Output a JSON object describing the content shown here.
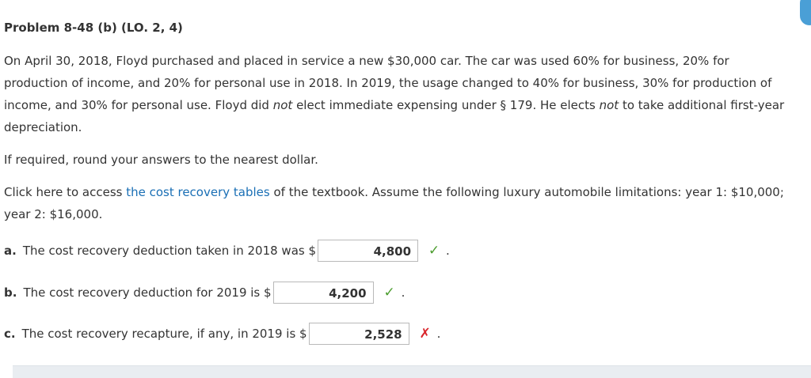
{
  "problem": {
    "title": "Problem 8-48 (b) (LO. 2, 4)",
    "para1_pre_not1": "On April 30, 2018, Floyd purchased and placed in service a new $30,000 car. The car was used 60% for business, 20% for production of income, and 20% for personal use in 2018. In 2019, the usage changed to 40% for business, 30% for production of income, and 30% for personal use. Floyd did ",
    "not1": "not",
    "para1_mid": " elect immediate expensing under § 179. He elects ",
    "not2": "not",
    "para1_post": " to take additional first-year depreciation.",
    "para2": "If required, round your answers to the nearest dollar.",
    "para3_pre": "Click here to access ",
    "para3_link": "the cost recovery tables",
    "para3_post": " of the textbook. Assume the following luxury automobile limitations: year 1: $10,000; year 2: $16,000."
  },
  "questions": [
    {
      "label": "a.",
      "text": "The cost recovery deduction taken in 2018 was $",
      "value": "4,800",
      "status": "correct",
      "mark": "✓"
    },
    {
      "label": "b.",
      "text": "The cost recovery deduction for 2019 is $",
      "value": "4,200",
      "status": "correct",
      "mark": "✓"
    },
    {
      "label": "c.",
      "text": "The cost recovery recapture, if any, in 2019 is $",
      "value": "2,528",
      "status": "incorrect",
      "mark": "✗"
    }
  ],
  "punctuation": {
    "period": "."
  },
  "colors": {
    "link": "#1a6fb5",
    "correct": "#4c9d2f",
    "incorrect": "#d9262c",
    "text": "#333333"
  }
}
